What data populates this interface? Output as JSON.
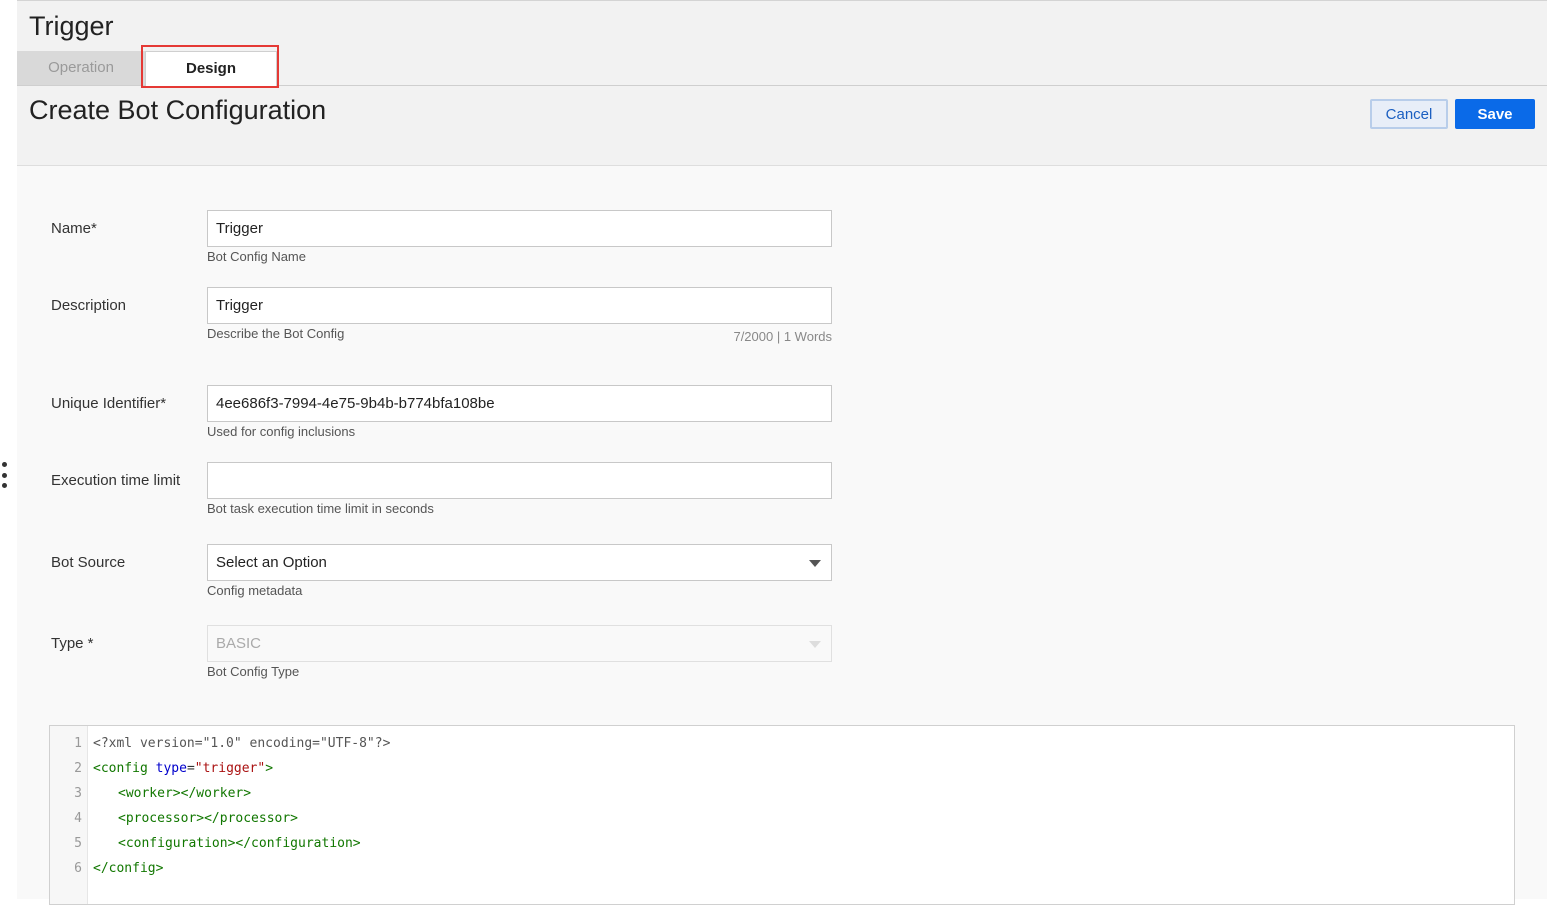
{
  "header": {
    "title": "Trigger",
    "tabs": [
      {
        "label": "Operation"
      },
      {
        "label": "Design"
      }
    ],
    "section_title": "Create Bot Configuration",
    "cancel_label": "Cancel",
    "save_label": "Save"
  },
  "form": {
    "name": {
      "label": "Name*",
      "value": "Trigger",
      "helper": "Bot Config Name"
    },
    "description": {
      "label": "Description",
      "value": "Trigger",
      "helper": "Describe the Bot Config",
      "counter": "7/2000 | 1 Words"
    },
    "unique_identifier": {
      "label": "Unique Identifier*",
      "value": "4ee686f3-7994-4e75-9b4b-b774bfa108be",
      "helper": "Used for config inclusions"
    },
    "execution_time_limit": {
      "label": "Execution time limit",
      "value": "",
      "helper": "Bot task execution time limit in seconds"
    },
    "bot_source": {
      "label": "Bot Source",
      "value": "Select an Option",
      "helper": "Config metadata"
    },
    "type": {
      "label": "Type *",
      "value": "BASIC",
      "helper": "Bot Config Type"
    }
  },
  "editor": {
    "line_numbers": [
      "1",
      "2",
      "3",
      "4",
      "5",
      "6"
    ],
    "lines": [
      {
        "meta": "<?xml version=\"1.0\" encoding=\"UTF-8\"?>"
      },
      {
        "open": "<config",
        "attr": "type",
        "eq": "=",
        "str": "\"trigger\"",
        "close": ">"
      },
      {
        "tag": "<worker></worker>"
      },
      {
        "tag": "<processor></processor>"
      },
      {
        "tag": "<configuration></configuration>"
      },
      {
        "tag": "</config>"
      }
    ]
  },
  "colors": {
    "accent": "#0a6ae8",
    "highlight_box": "#e53935",
    "xml_tag": "#117700",
    "xml_attr": "#0000cc",
    "xml_string": "#aa1111"
  },
  "icons": {
    "kebab": "kebab-menu-icon",
    "select": "chevron-down-icon"
  }
}
